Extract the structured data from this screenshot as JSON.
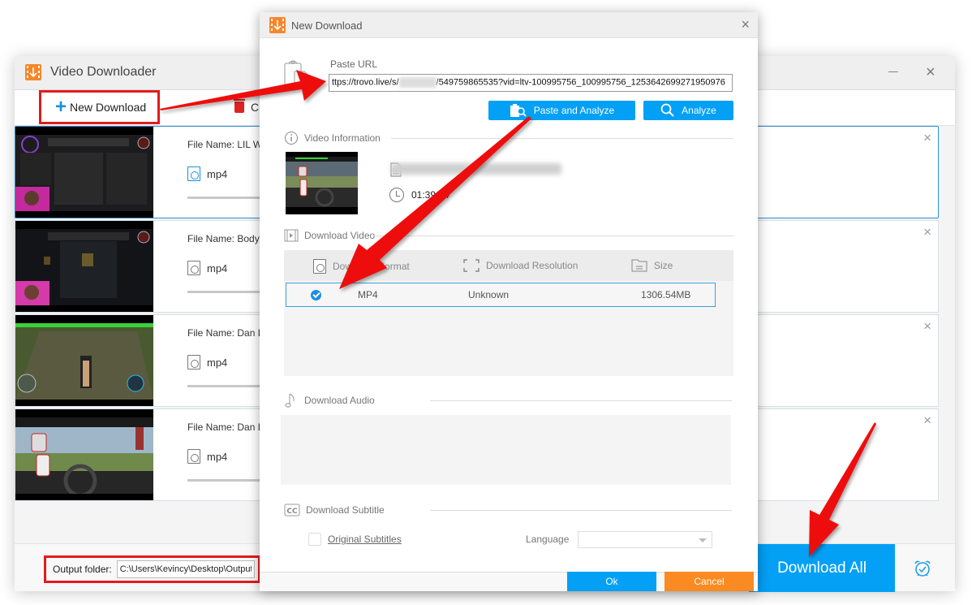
{
  "main_window": {
    "title": "Video Downloader",
    "close_glyph": "×",
    "toolbar": {
      "new_download_label": "New Download",
      "new_download_icon": "plus-icon",
      "clear_label": "C",
      "clear_icon": "trash-icon"
    },
    "items": [
      {
        "file_name": "File Name: LIL W",
        "format": "mp4",
        "active": true,
        "close_glyph": "×"
      },
      {
        "file_name": "File Name: Bodyc",
        "format": "mp4",
        "active": false,
        "close_glyph": "×"
      },
      {
        "file_name": "File Name: Dan L",
        "format": "mp4",
        "active": false,
        "close_glyph": "×"
      },
      {
        "file_name": "File Name: Dan L",
        "format": "mp4",
        "active": false,
        "close_glyph": "×"
      }
    ],
    "footer": {
      "output_label": "Output folder:",
      "output_path": "C:\\Users\\Kevincy\\Desktop\\Output",
      "download_all_label": "Download All",
      "alarm_icon": "alarm-clock-icon"
    }
  },
  "dialog": {
    "title": "New Download",
    "close_glyph": "×",
    "paste_url_label": "Paste URL",
    "url_prefix": "ttps://trovo.live/s/",
    "url_suffix": "/549759865535?vid=ltv-100995756_100995756_1253642699271950976",
    "paste_analyze_label": "Paste and Analyze",
    "analyze_label": "Analyze",
    "video_info": {
      "section_label": "Video Information",
      "duration": "01:39:44"
    },
    "download_video": {
      "section_label": "Download Video",
      "columns": [
        "Download Format",
        "Download Resolution",
        "Size"
      ],
      "rows": [
        {
          "format": "MP4",
          "resolution": "Unknown",
          "size": "1306.54MB",
          "selected": true
        }
      ]
    },
    "download_audio": {
      "section_label": "Download Audio"
    },
    "download_subtitle": {
      "section_label": "Download Subtitle",
      "original_subtitles_label": "Original Subtitles",
      "language_label": "Language",
      "language_value": ""
    },
    "ok_label": "Ok",
    "cancel_label": "Cancel"
  },
  "colors": {
    "accent_blue": "#03a0f5",
    "cancel_orange": "#fa8a22",
    "annotation_red": "#e31b1b",
    "logo_orange": "#f7862a"
  }
}
